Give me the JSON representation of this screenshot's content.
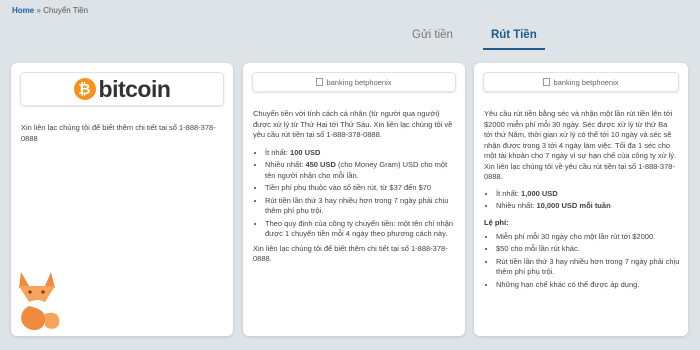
{
  "breadcrumb": {
    "home": "Home",
    "separator": " » ",
    "current": "Chuyển Tiền"
  },
  "tabs": [
    {
      "label": "Gửi tiền",
      "active": false
    },
    {
      "label": "Rút Tiền",
      "active": true
    }
  ],
  "bitcoin_card": {
    "logo_symbol": "₿",
    "logo_text": "bitcoin",
    "description": "Xin liên lạc chúng tôi để biết thêm chi tiết tại số 1-888-378-0888"
  },
  "banking_card": {
    "image_alt": "banking betphoenix",
    "intro": "Chuyển tiền với tính cách cá nhân (từ người qua người) được xử lý từ Thứ Hai tới Thứ Sáu. Xin liên lạc chúng tôi về yêu cầu rút tiền tại số 1-888-378-0888.",
    "items": [
      {
        "label": "Ít nhất: ",
        "value": "100 USD",
        "rest": ""
      },
      {
        "label": "Nhiều nhất: ",
        "value": "450 USD",
        "rest": " (cho Money Gram) USD cho một tên người nhận cho mỗi lần."
      },
      {
        "label": "Tiền phí phụ thuộc vào số tiền rút, từ $37 đến $70",
        "value": "",
        "rest": ""
      },
      {
        "label": "Rút tiền lần thứ 3 hay nhiều hơn trong 7 ngày phải chịu thêm phí phụ trội.",
        "value": "",
        "rest": ""
      },
      {
        "label": "Theo quy định của công ty chuyển tiền: một tên chỉ nhận được 1 chuyển tiền mỗi 4 ngày theo phương cách này.",
        "value": "",
        "rest": ""
      }
    ],
    "footer": "Xin liên lạc chúng tôi để biết thêm chi tiết tại số 1-888-378-0888."
  },
  "check_card": {
    "image_alt": "banking betphoenix",
    "intro": "Yêu cầu rút tiền bằng séc và nhận một lần rút tiền lên tới $2000 miễn phí mỗi 30 ngày. Séc được xử lý từ thứ Ba tới thứ Năm, thời gian xử lý có thể tới 10 ngày và séc sẽ nhận được trong 3 tới 4 ngày làm việc. Tối đa 1 séc cho một tài khoản cho 7 ngày vì sự hạn chế của công ty xử lý. Xin liên lạc chúng tôi về yêu cầu rút tiền tại số 1-888-378-0888.",
    "limits": [
      {
        "label": "Ít nhất: ",
        "value": "1,000 USD"
      },
      {
        "label": "Nhiều nhất: ",
        "value": "10,000 USD mỗi tuần"
      }
    ],
    "fee_title": "Lệ phí:",
    "fees": [
      "Miễn phí mỗi 30 ngày cho một lần rút tới $2000.",
      "$50 cho mỗi lần rút khác.",
      "Rút tiền lần thứ 3 hay nhiều hơn trong 7 ngày phải chịu thêm phí phụ trội.",
      "Những hạn chế khác có thể được áp dụng."
    ]
  },
  "colors": {
    "background": "#dde3e6",
    "accent": "#1e5a8a",
    "bitcoin": "#f7931a",
    "fox": "#f08a3c"
  },
  "icons": [
    "bitcoin-logo-icon",
    "broken-image-icon",
    "fox-mascot-icon"
  ]
}
